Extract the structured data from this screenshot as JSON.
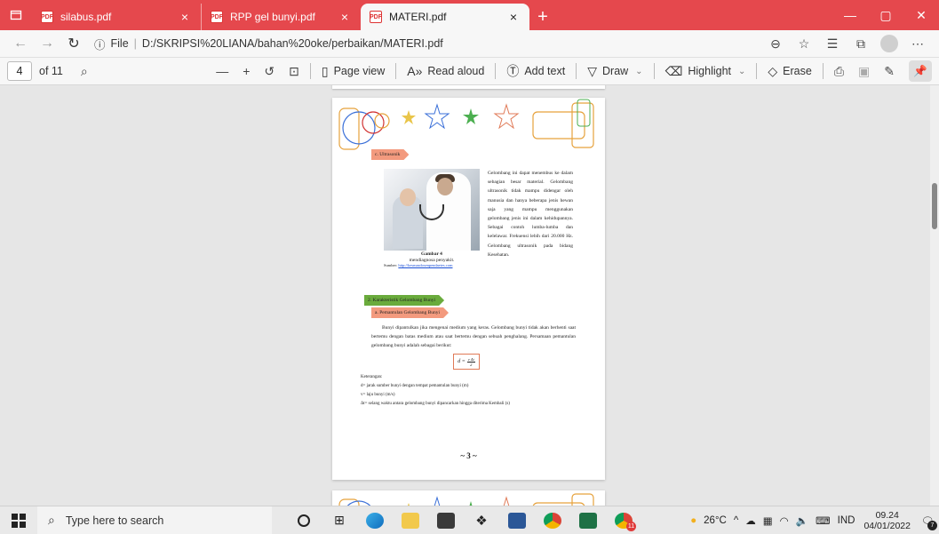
{
  "browser": {
    "tabs": [
      {
        "label": "silabus.pdf",
        "icon": "pdf-icon"
      },
      {
        "label": "RPP gel bunyi.pdf",
        "icon": "pdf-icon"
      },
      {
        "label": "MATERI.pdf",
        "icon": "pdf-icon",
        "active": true
      }
    ],
    "close_glyph": "×",
    "new_tab_glyph": "+",
    "window_controls": [
      "—",
      "▢",
      "✕"
    ],
    "address": {
      "scheme_label": "File",
      "url": "D:/SKRIPSI%20LIANA/bahan%20oke/perbaikan/MATERI.pdf"
    }
  },
  "pdf_toolbar": {
    "page_current": "4",
    "page_total": "of 11",
    "page_view": "Page view",
    "read_aloud": "Read aloud",
    "add_text": "Add text",
    "draw": "Draw",
    "highlight": "Highlight",
    "erase": "Erase"
  },
  "document": {
    "section_tag_c": "c.   Ultrasonik",
    "right_column": "Gelombang ini dapat menembus ke dalam sebagian besar material. Gelombang ultrasonik tidak mampu didengar oleh manusia dan hanya beberapa jenis hewan saja yang mampu menggunakan gelombang jenis ini dalam kehidupannya. Sebagai contoh lumba-lumba dan kelelawar. Frekuensi lebih dari 20.000 Hz. Gelombang ultrasonik pada bidang Kesehatan.",
    "figure_title": "Gambar 4",
    "figure_desc": "mendiagnosa penyakit.",
    "figure_source_label": "Sumber:",
    "figure_source_link": "http://kesmasdosenpendaetes.com",
    "section_tag_2": "2.   Karakteristik Gelombang Bunyi",
    "section_tag_a": "a.   Pemantulan   Gelombang   Bunyi",
    "paragraph": "Bunyi dipantulkan jika mengenai medium yang keras. Gelombang bunyi tidak akan berhenti saat bertemu dengan batas medium atau saat bertemu dengan sebuah penghalang. Persamaan pemantulan gelombang bunyi adalah sebagai berikut:",
    "formula_lhs": "d =",
    "formula_num": "v Δt",
    "formula_den": "2",
    "notes_title": "Keterangan:",
    "note_d": "d= jarak sumber bunyi dengan tempat pemantulan bunyi (m)",
    "note_v": "v= laju bunyi (m/s)",
    "note_dt": "Δt= selang waktu antara gelombang bunyi dipancarkan hingga diterima Kembali (s)",
    "page_number": "~ 3 ~"
  },
  "taskbar": {
    "search_placeholder": "Type here to search",
    "weather": "26°C",
    "language": "IND",
    "time": "09.24",
    "date": "04/01/2022",
    "chrome_badge": "11",
    "notif_badge": "7"
  },
  "colors": {
    "tab_bar": "#e5484d",
    "tag_salmon": "#f39a7e",
    "tag_green": "#6aab3c"
  }
}
